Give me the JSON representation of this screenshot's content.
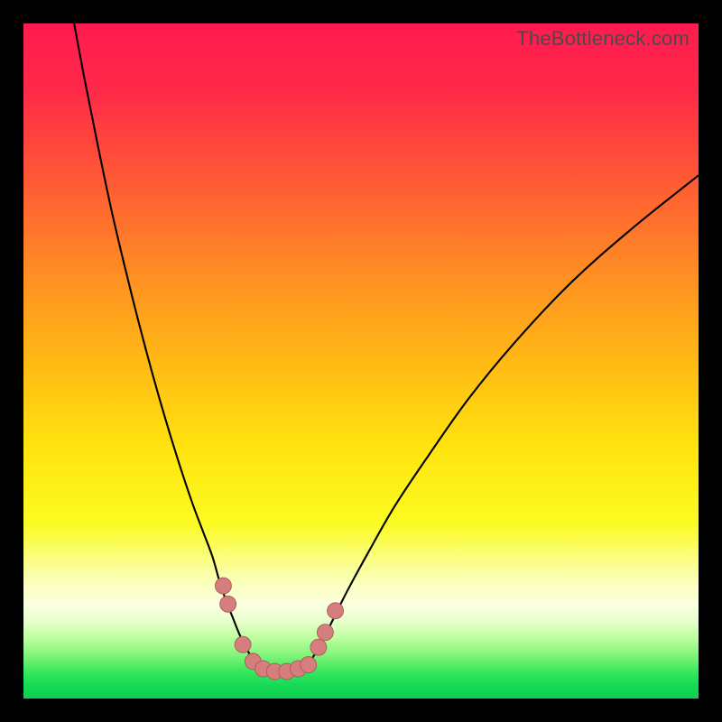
{
  "watermark": "TheBottleneck.com",
  "colors": {
    "background_black": "#000000",
    "curve_stroke": "#000000",
    "marker_fill": "#d67d7d",
    "marker_stroke": "#a85a5a",
    "watermark_text": "#4a4a4a"
  },
  "gradient_stops": [
    {
      "offset": 0.0,
      "color": "#ff1a4f"
    },
    {
      "offset": 0.1,
      "color": "#ff2a49"
    },
    {
      "offset": 0.22,
      "color": "#ff5536"
    },
    {
      "offset": 0.36,
      "color": "#ff8a24"
    },
    {
      "offset": 0.5,
      "color": "#ffb914"
    },
    {
      "offset": 0.63,
      "color": "#ffe40f"
    },
    {
      "offset": 0.74,
      "color": "#fbfb22"
    },
    {
      "offset": 0.82,
      "color": "#faffb0"
    },
    {
      "offset": 0.86,
      "color": "#fcffe0"
    },
    {
      "offset": 0.885,
      "color": "#e8ffcc"
    },
    {
      "offset": 0.91,
      "color": "#bdffa0"
    },
    {
      "offset": 0.935,
      "color": "#84f57a"
    },
    {
      "offset": 0.96,
      "color": "#37e85b"
    },
    {
      "offset": 0.98,
      "color": "#15db56"
    },
    {
      "offset": 1.0,
      "color": "#0fce52"
    }
  ],
  "chart_data": {
    "type": "line",
    "title": "",
    "xlabel": "",
    "ylabel": "",
    "xlim": [
      0,
      100
    ],
    "ylim": [
      0,
      100
    ],
    "note": "percent-of-plot-area coordinates; y origin at top",
    "series": [
      {
        "name": "left-curve",
        "x": [
          7.5,
          9,
          11,
          13,
          15,
          17,
          19,
          21,
          23,
          25,
          26.5,
          28,
          29,
          30,
          31,
          32,
          33,
          33.8
        ],
        "y": [
          0,
          8,
          18,
          27.5,
          36,
          44,
          51.5,
          58.5,
          65,
          71,
          75,
          79,
          82.5,
          85.5,
          88,
          90.5,
          92.5,
          94
        ]
      },
      {
        "name": "right-curve",
        "x": [
          42.8,
          44,
          46,
          48,
          51,
          55,
          60,
          66,
          73,
          81,
          90,
          100
        ],
        "y": [
          94,
          92,
          88,
          84,
          78.5,
          71.5,
          64,
          55.5,
          47,
          38.5,
          30.5,
          22.5
        ]
      },
      {
        "name": "valley-floor",
        "x": [
          33.8,
          35,
          37,
          39,
          41,
          42.8
        ],
        "y": [
          94,
          95.7,
          96.2,
          96.2,
          95.7,
          94
        ]
      }
    ],
    "markers": {
      "name": "highlighted-points",
      "points": [
        {
          "x": 29.6,
          "y": 83.3
        },
        {
          "x": 30.3,
          "y": 86.0
        },
        {
          "x": 32.5,
          "y": 92.0
        },
        {
          "x": 34.0,
          "y": 94.5
        },
        {
          "x": 35.5,
          "y": 95.6
        },
        {
          "x": 37.2,
          "y": 96.0
        },
        {
          "x": 39.0,
          "y": 96.0
        },
        {
          "x": 40.7,
          "y": 95.6
        },
        {
          "x": 42.2,
          "y": 95.0
        },
        {
          "x": 43.7,
          "y": 92.4
        },
        {
          "x": 44.7,
          "y": 90.2
        },
        {
          "x": 46.2,
          "y": 87.0
        }
      ],
      "radius_percent": 1.2
    }
  }
}
